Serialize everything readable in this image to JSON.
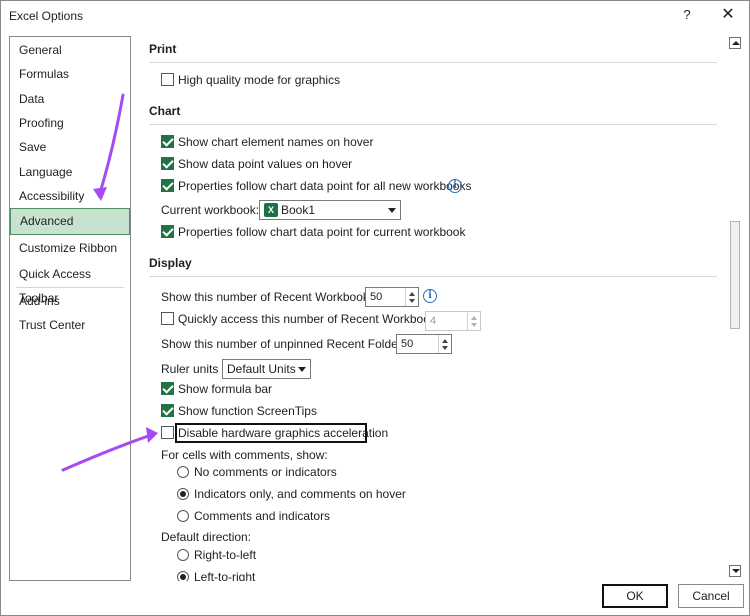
{
  "window": {
    "title": "Excel Options",
    "help_label": "?",
    "close_label": "✕"
  },
  "nav": {
    "items": [
      {
        "label": "General"
      },
      {
        "label": "Formulas"
      },
      {
        "label": "Data"
      },
      {
        "label": "Proofing"
      },
      {
        "label": "Save"
      },
      {
        "label": "Language"
      },
      {
        "label": "Accessibility"
      },
      {
        "label": "Advanced"
      },
      {
        "label": "Customize Ribbon"
      },
      {
        "label": "Quick Access Toolbar"
      },
      {
        "label": "Add-ins"
      },
      {
        "label": "Trust Center"
      }
    ],
    "active": "Advanced"
  },
  "print": {
    "title": "Print",
    "high_quality": {
      "label": "High quality mode for graphics",
      "checked": false
    }
  },
  "chart": {
    "title": "Chart",
    "show_names": {
      "label": "Show chart element names on hover",
      "checked": true
    },
    "show_values": {
      "label": "Show data point values on hover",
      "checked": true
    },
    "follow_all": {
      "label": "Properties follow chart data point for all new workbooks",
      "checked": true
    },
    "current_workbook_label": "Current workbook:",
    "current_workbook_value": "Book1",
    "follow_current": {
      "label": "Properties follow chart data point for current workbook",
      "checked": true
    }
  },
  "display": {
    "title": "Display",
    "recent_workbooks_label": "Show this number of Recent Workbooks:",
    "recent_workbooks_value": "50",
    "quick_access": {
      "label": "Quickly access this number of Recent Workbooks:",
      "checked": false
    },
    "quick_access_value": "4",
    "unpinned_folders_label": "Show this number of unpinned Recent Folders:",
    "unpinned_folders_value": "50",
    "ruler_units_label": "Ruler units",
    "ruler_units_value": "Default Units",
    "formula_bar": {
      "label": "Show formula bar",
      "checked": true
    },
    "screen_tips": {
      "label": "Show function ScreenTips",
      "checked": true
    },
    "disable_hw": {
      "label": "Disable hardware graphics acceleration",
      "checked": false
    },
    "comments_label": "For cells with comments, show:",
    "comment_options": [
      {
        "label": "No comments or indicators",
        "checked": false
      },
      {
        "label": "Indicators only, and comments on hover",
        "checked": true
      },
      {
        "label": "Comments and indicators",
        "checked": false
      }
    ],
    "direction_label": "Default direction:",
    "direction_options": [
      {
        "label": "Right-to-left",
        "checked": false
      },
      {
        "label": "Left-to-right",
        "checked": true
      }
    ]
  },
  "footer": {
    "ok_label": "OK",
    "cancel_label": "Cancel"
  },
  "colors": {
    "accent": "#217346",
    "active_nav_bg": "#c7e3cf",
    "annotation_arrow": "#a64bf4",
    "info_icon": "#2a6fc0"
  },
  "icons": {
    "info": "info-icon",
    "excel": "excel-workbook-icon",
    "help": "help-icon",
    "close": "close-icon"
  },
  "excel_icon_letter": "X"
}
